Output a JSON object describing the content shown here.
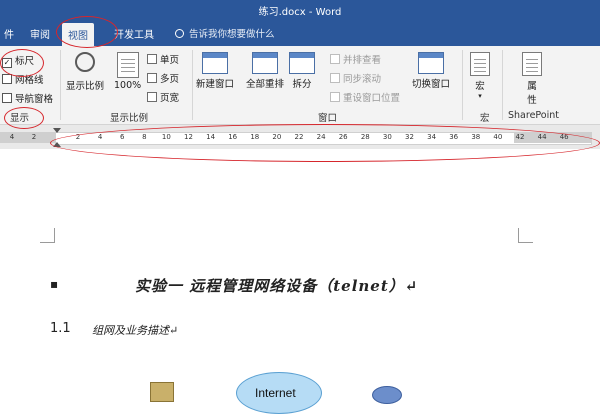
{
  "window": {
    "title": "练习.docx - Word"
  },
  "tabs": [
    {
      "label": "件"
    },
    {
      "label": "审阅"
    },
    {
      "label": "视图"
    },
    {
      "label": "开发工具"
    }
  ],
  "tell_me": {
    "placeholder": "告诉我你想要做什么"
  },
  "ribbon": {
    "show_group": {
      "label": "显示",
      "checkboxes": [
        {
          "label": "标尺",
          "checked": true
        },
        {
          "label": "网格线",
          "checked": false
        },
        {
          "label": "导航窗格",
          "checked": false
        }
      ]
    },
    "zoom_group": {
      "label": "显示比例",
      "zoom_button": "显示比例",
      "percent_button": "100%",
      "one_page": "单页",
      "multi_page": "多页",
      "page_width": "页宽"
    },
    "window_group": {
      "label": "窗口",
      "new_window": "新建窗口",
      "arrange_all": "全部重排",
      "split": "拆分",
      "side_by_side": "并排查看",
      "sync_scroll": "同步滚动",
      "reset_position": "重设窗口位置",
      "switch_windows": "切换窗口"
    },
    "macro_group": {
      "label": "宏",
      "button": "宏"
    },
    "sharepoint_group": {
      "label": "SharePoint",
      "button_line1": "属",
      "button_line2": "性"
    }
  },
  "ruler": {
    "left_ticks": [
      "4",
      "2"
    ],
    "ticks": [
      "2",
      "4",
      "6",
      "8",
      "10",
      "12",
      "14",
      "16",
      "18",
      "20",
      "22",
      "24",
      "26",
      "28",
      "30",
      "32",
      "34",
      "36",
      "38",
      "40",
      "42",
      "44",
      "46"
    ]
  },
  "document": {
    "heading": "实验一  远程管理网络设备（telnet）↵",
    "section_number": "1.1",
    "section_text": "组网及业务描述↵",
    "diagram_label": "Internet"
  },
  "colors": {
    "title_bar": "#2b579a",
    "ribbon_bg": "#f3f3f3",
    "annotation": "#d6262c"
  }
}
